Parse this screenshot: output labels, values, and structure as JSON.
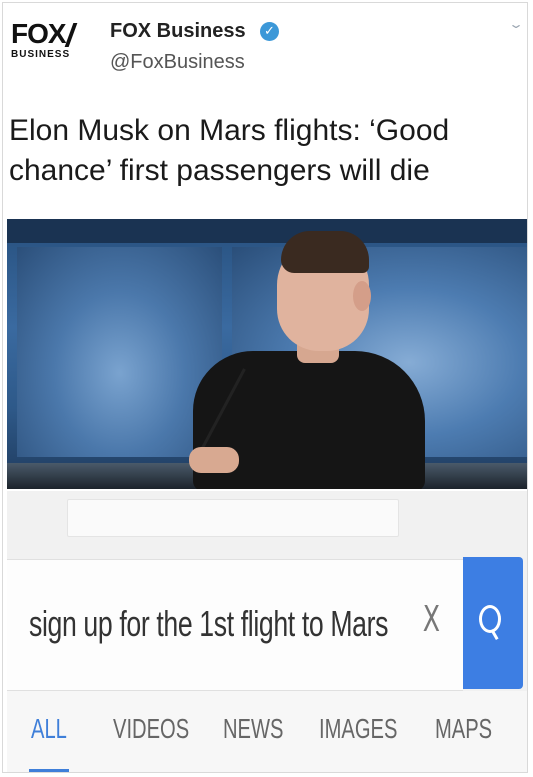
{
  "tweet": {
    "logo": {
      "main": "FOX",
      "sub": "BUSINESS"
    },
    "account_name": "FOX Business",
    "handle": "@FoxBusiness",
    "verified_icon": "check-badge-icon",
    "menu_icon": "chevron-down-icon",
    "headline": "Elon Musk on Mars flights: ‘Good chance’ first passengers will die"
  },
  "search": {
    "query": "sign up for the 1st flight to Mars",
    "clear_label": "X",
    "search_icon": "search-icon",
    "tabs": [
      {
        "label": "ALL",
        "active": true
      },
      {
        "label": "VIDEOS",
        "active": false
      },
      {
        "label": "NEWS",
        "active": false
      },
      {
        "label": "IMAGES",
        "active": false
      },
      {
        "label": "MAPS",
        "active": false
      }
    ]
  },
  "colors": {
    "accent_blue": "#3f7fd9",
    "verified_blue": "#3c98d8",
    "search_button": "#3d7ee3"
  }
}
